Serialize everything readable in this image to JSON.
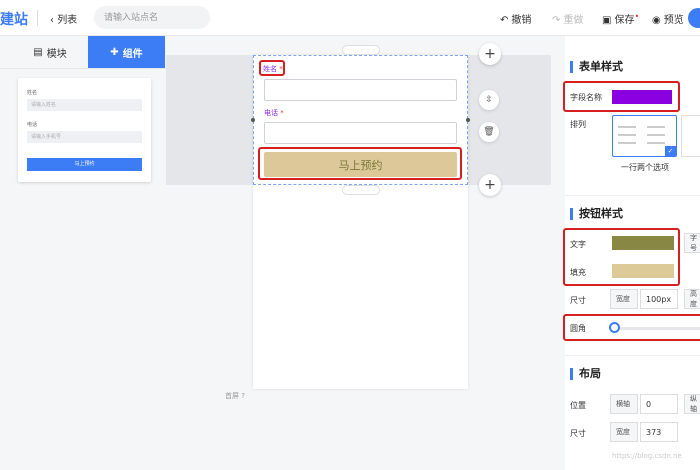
{
  "topbar": {
    "logo": "建站",
    "back_label": "列表",
    "site_placeholder": "请输入站点名",
    "undo": "撤销",
    "redo": "重做",
    "save": "保存",
    "save_dot": "•",
    "preview": "预览"
  },
  "left": {
    "tab_modules": "模块",
    "tab_components": "组件",
    "thumb": {
      "name_label": "姓名",
      "name_placeholder": "请输入姓名",
      "phone_label": "电话",
      "phone_placeholder": "请输入手机号",
      "button": "马上预约"
    }
  },
  "canvas": {
    "name_label": "姓名",
    "phone_label": "电话",
    "required_mark": "*",
    "submit_label": "马上预约",
    "footer_note": "首屏"
  },
  "right": {
    "form_style_title": "表单样式",
    "field_name_label": "字段名称",
    "arrange_label": "排列",
    "arrange_option": "一行两个选项",
    "button_style_title": "按钮样式",
    "text_label": "文字",
    "size_cut": "字号",
    "fill_label": "填充",
    "size_label": "尺寸",
    "width_label": "宽度",
    "width_value": "100px",
    "height_cut": "高度",
    "radius_label": "圆角",
    "layout_title": "布局",
    "position_label": "位置",
    "x_axis_label": "横轴",
    "x_value": "0",
    "y_axis_cut": "纵轴",
    "size2_label": "尺寸",
    "width2_label": "宽度",
    "width2_value": "373",
    "watermark": "https://blog.csdn.ne"
  },
  "colors": {
    "accent": "#3c7cf5",
    "field_name_color": "#8a00e0",
    "button_text_color": "#888844",
    "button_fill_color": "#dccb98",
    "highlight_red": "#d62020"
  }
}
